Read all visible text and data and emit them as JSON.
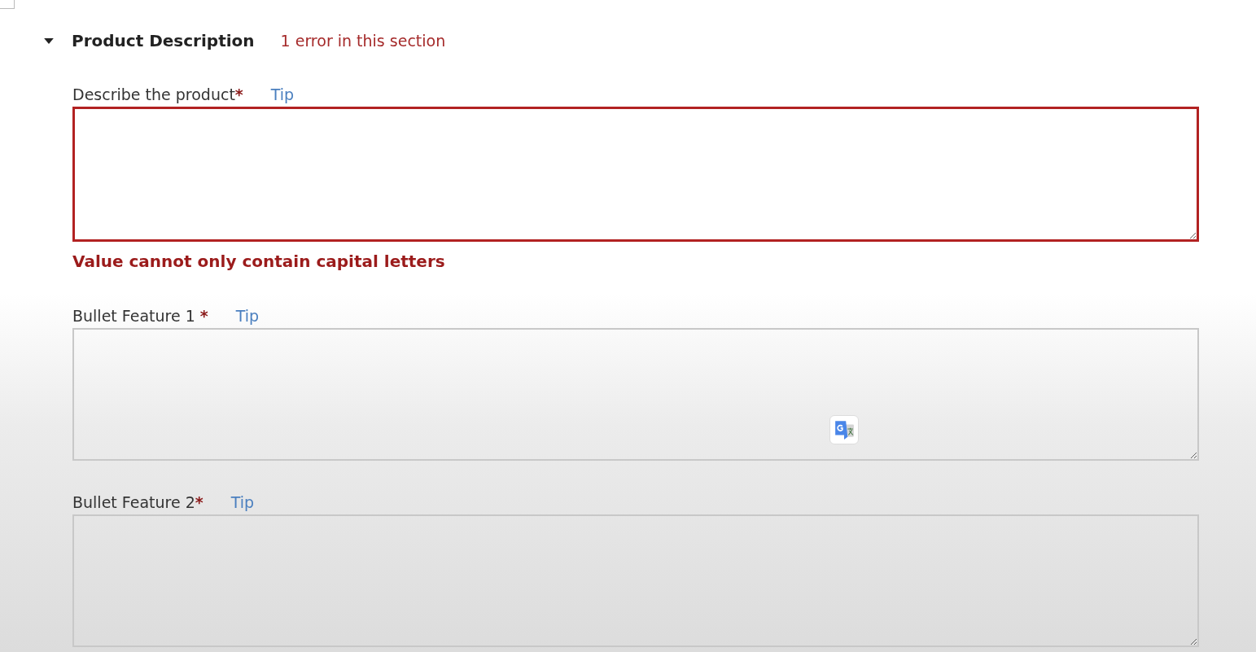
{
  "section": {
    "title": "Product Description",
    "expanded": true,
    "error_summary": "1 error in this section"
  },
  "fields": [
    {
      "label": "Describe the product",
      "required_mark": "*",
      "tip": "Tip",
      "error": true,
      "error_message": "Value cannot only contain capital letters",
      "translate_badge": false
    },
    {
      "label": "Bullet Feature 1 ",
      "required_mark": "*",
      "tip": "Tip",
      "error": false,
      "translate_badge": true
    },
    {
      "label": "Bullet Feature 2",
      "required_mark": "*",
      "tip": "Tip",
      "error": false,
      "translate_badge": false
    }
  ]
}
